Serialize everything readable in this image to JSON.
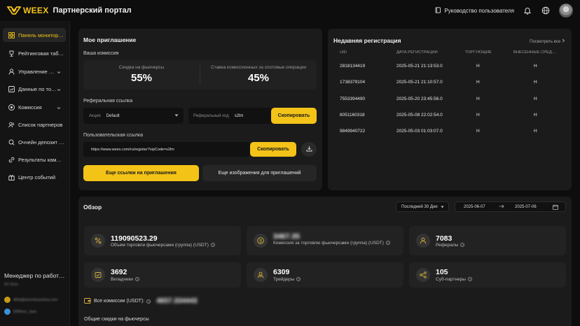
{
  "header": {
    "logo_text": "WEEX",
    "portal_title": "Партнерский портал",
    "guide_label": "Руководство пользователя"
  },
  "sidebar": {
    "items": [
      {
        "label": "Панель монитор…",
        "icon": "dashboard-icon",
        "active": true
      },
      {
        "label": "Рейтинговая таб…",
        "icon": "trophy-icon"
      },
      {
        "label": "Управление …",
        "icon": "user-icon",
        "expand": true
      },
      {
        "label": "Данные по то…",
        "icon": "chart-icon",
        "expand": true
      },
      {
        "label": "Комиссия",
        "icon": "coin-icon",
        "expand": true
      },
      {
        "label": "Список партнеров",
        "icon": "users-icon"
      },
      {
        "label": "Оччейн депозит …",
        "icon": "search-icon"
      },
      {
        "label": "Результаты кам…",
        "icon": "link-icon"
      },
      {
        "label": "Центр событий",
        "icon": "gift-icon"
      }
    ],
    "manager_title": "Менеджер по работ…",
    "manager_name": "BD Weta",
    "contact_email": "dbfa@weexdcanetsa.com",
    "contact_telegram": "ElWeex_Jaxs"
  },
  "invite": {
    "title": "Мое приглашение",
    "commission_label": "Ваша комиссия",
    "futures_discount_label": "Скидка на фьючерсы",
    "futures_discount_value": "55%",
    "spot_rate_label": "Ставка комиссионных за спотовые операции",
    "spot_rate_value": "45%",
    "ref_link_label": "Реферальная ссылка",
    "promo_label": "Акция",
    "promo_value": "Default",
    "ref_code_label": "Реферальный код",
    "ref_code_value": "s2lm",
    "copy_label": "Скопировать",
    "custom_link_label": "Пользовательская ссылка",
    "custom_link_value": "https://www.weex.com/ru/register?vipCode=s2lm",
    "copy_label_2": "Скопировать",
    "more_links_label": "Еще ссылки на приглашения",
    "more_images_label": "Еще изображения для приглашений"
  },
  "registrations": {
    "title": "Недавняя регистрация",
    "see_all_label": "Посмотреть все",
    "columns": [
      "UID",
      "ДАТА РЕГИСТРАЦИИ",
      "ТОРГУЮЩИЕ",
      "ВНЕСЕННЫЕ СРЕД…"
    ],
    "rows": [
      [
        "2818134419",
        "2025-05-21 21:13:53.0",
        "Н",
        "Н"
      ],
      [
        "1738379104",
        "2025-05-21 21:10:57.0",
        "Н",
        "Н"
      ],
      [
        "7553394490",
        "2025-05-20 23:45:56.0",
        "Н",
        "Н"
      ],
      [
        "8051160318",
        "2025-05-08 22:02:54.0",
        "Н",
        "Н"
      ],
      [
        "9849940722",
        "2025-05-03 01:03:07.0",
        "Н",
        "Н"
      ]
    ]
  },
  "overview": {
    "title": "Обзор",
    "period_label": "Последний 30 Дни",
    "date_from": "2025-06-07",
    "date_to": "2025-07-06",
    "stats": [
      {
        "value": "119090523.29",
        "label": "Объем торговли фьючерсами (группа) (USDT)",
        "icon": "percent-icon"
      },
      {
        "value": "3467.35",
        "label": "Комиссия за торговлю фьючерсами (группа) (USDT)",
        "icon": "dollar-icon",
        "blurred": true
      },
      {
        "value": "7083",
        "label": "Рефералы",
        "icon": "user-icon"
      },
      {
        "value": "3692",
        "label": "Вкладчики",
        "icon": "deposit-icon"
      },
      {
        "value": "6309",
        "label": "Трейдеры",
        "icon": "traders-icon"
      },
      {
        "value": "105",
        "label": "Суб-партнеры",
        "icon": "network-icon"
      }
    ],
    "total_commission_label": "Все комиссии (USDT):",
    "total_commission_value": "4657.334443",
    "discounts_label": "Общие скидки на фьючерсы"
  },
  "colors": {
    "accent": "#f3c318",
    "background": "#0d0d0d",
    "card": "#1b1b1b"
  }
}
